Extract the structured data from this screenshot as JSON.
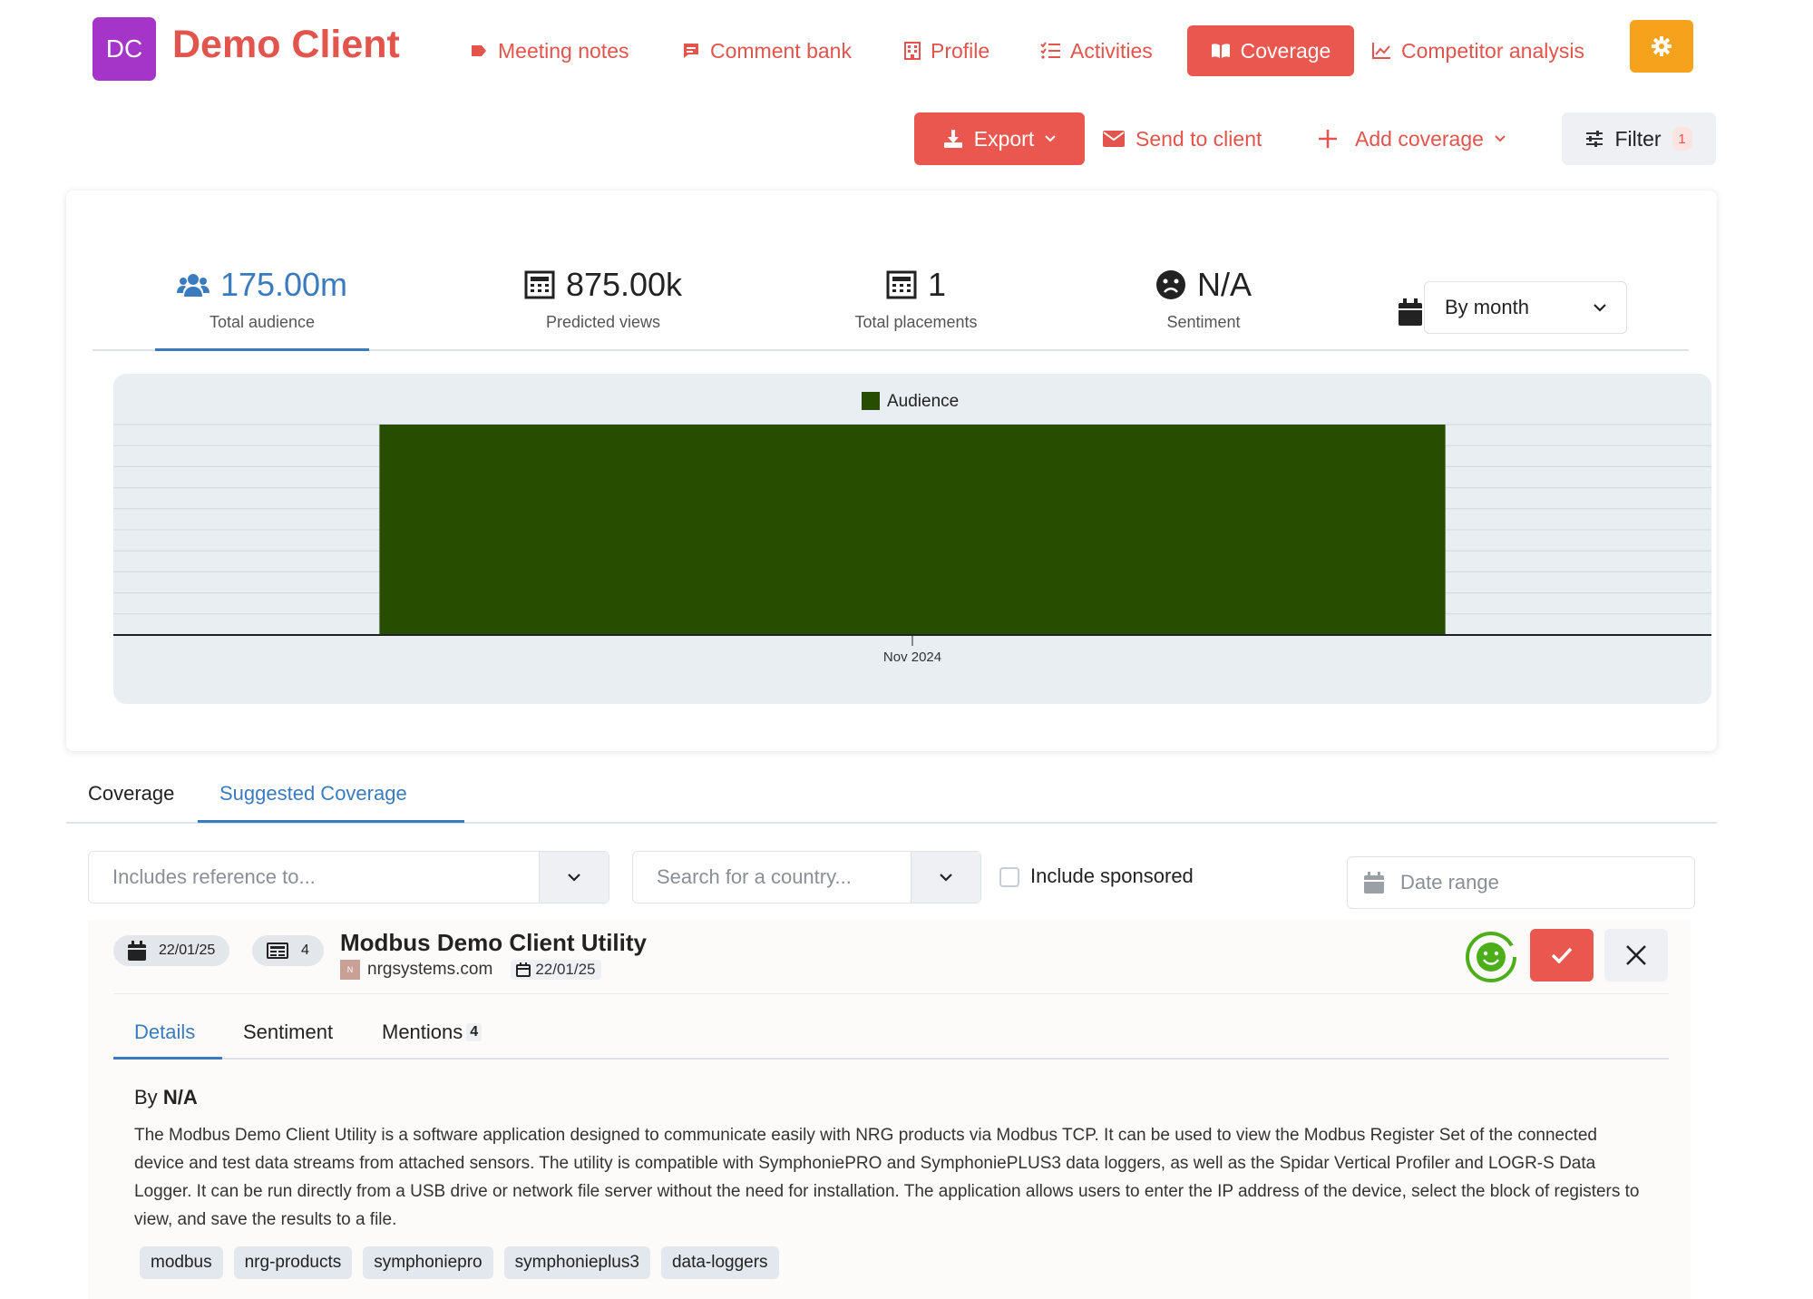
{
  "header": {
    "logo_initials": "DC",
    "client_name": "Demo Client",
    "nav": [
      {
        "label": "Meeting notes",
        "icon": "tag-icon"
      },
      {
        "label": "Comment bank",
        "icon": "comment-icon"
      },
      {
        "label": "Profile",
        "icon": "building-icon"
      },
      {
        "label": "Activities",
        "icon": "list-check-icon"
      },
      {
        "label": "Coverage",
        "icon": "book-open-icon",
        "active": true
      },
      {
        "label": "Competitor analysis",
        "icon": "chart-line-icon"
      }
    ],
    "settings_icon": "gear-icon"
  },
  "actions": {
    "export_label": "Export",
    "send_label": "Send to client",
    "add_label": "Add coverage",
    "filter_label": "Filter",
    "filter_count": "1"
  },
  "stats": [
    {
      "value": "175.00m",
      "label": "Total audience",
      "icon": "users-icon",
      "active": true
    },
    {
      "value": "875.00k",
      "label": "Predicted views",
      "icon": "newspaper-icon"
    },
    {
      "value": "1",
      "label": "Total placements",
      "icon": "newspaper-icon"
    },
    {
      "value": "N/A",
      "label": "Sentiment",
      "icon": "frown-icon"
    }
  ],
  "period": {
    "label": "By month",
    "icon": "calendar-icon"
  },
  "chart_data": {
    "type": "bar",
    "categories": [
      "Nov 2024"
    ],
    "series": [
      {
        "name": "Audience",
        "values": [
          175000000
        ],
        "color": "#264d00"
      }
    ],
    "legend": "top-center",
    "grid": true,
    "ylim": [
      0,
      175000000
    ]
  },
  "tabs": [
    {
      "label": "Coverage"
    },
    {
      "label": "Suggested Coverage",
      "active": true
    }
  ],
  "filters": {
    "reference_placeholder": "Includes reference to...",
    "country_placeholder": "Search for a country...",
    "sponsored_label": "Include sponsored",
    "sponsored_checked": false,
    "date_placeholder": "Date range"
  },
  "item": {
    "date_pill": "22/01/25",
    "count_pill": "4",
    "title": "Modbus Demo Client Utility",
    "source": "nrgsystems.com",
    "favicon_letter": "N",
    "published": "22/01/25",
    "sentiment": "positive",
    "tabs": [
      {
        "label": "Details",
        "active": true
      },
      {
        "label": "Sentiment"
      },
      {
        "label": "Mentions",
        "count": "4"
      }
    ],
    "by_prefix": "By",
    "author": "N/A",
    "description": "The Modbus Demo Client Utility is a software application designed to communicate easily with NRG products via Modbus TCP. It can be used to view the Modbus Register Set of the connected device and test data streams from attached sensors. The utility is compatible with SymphoniePRO and SymphoniePLUS3 data loggers, as well as the Spidar Vertical Profiler and LOGR-S Data Logger. It can be run directly from a USB drive or network file server without the need for installation. The application allows users to enter the IP address of the device, select the block of registers to view, and save the results to a file.",
    "tags": [
      "modbus",
      "nrg-products",
      "symphoniepro",
      "symphonieplus3",
      "data-loggers"
    ]
  },
  "colors": {
    "accent": "#e9574f",
    "link": "#3a7bbf",
    "brand_logo": "#a534c8",
    "settings": "#f6a21c",
    "bar": "#264d00"
  }
}
